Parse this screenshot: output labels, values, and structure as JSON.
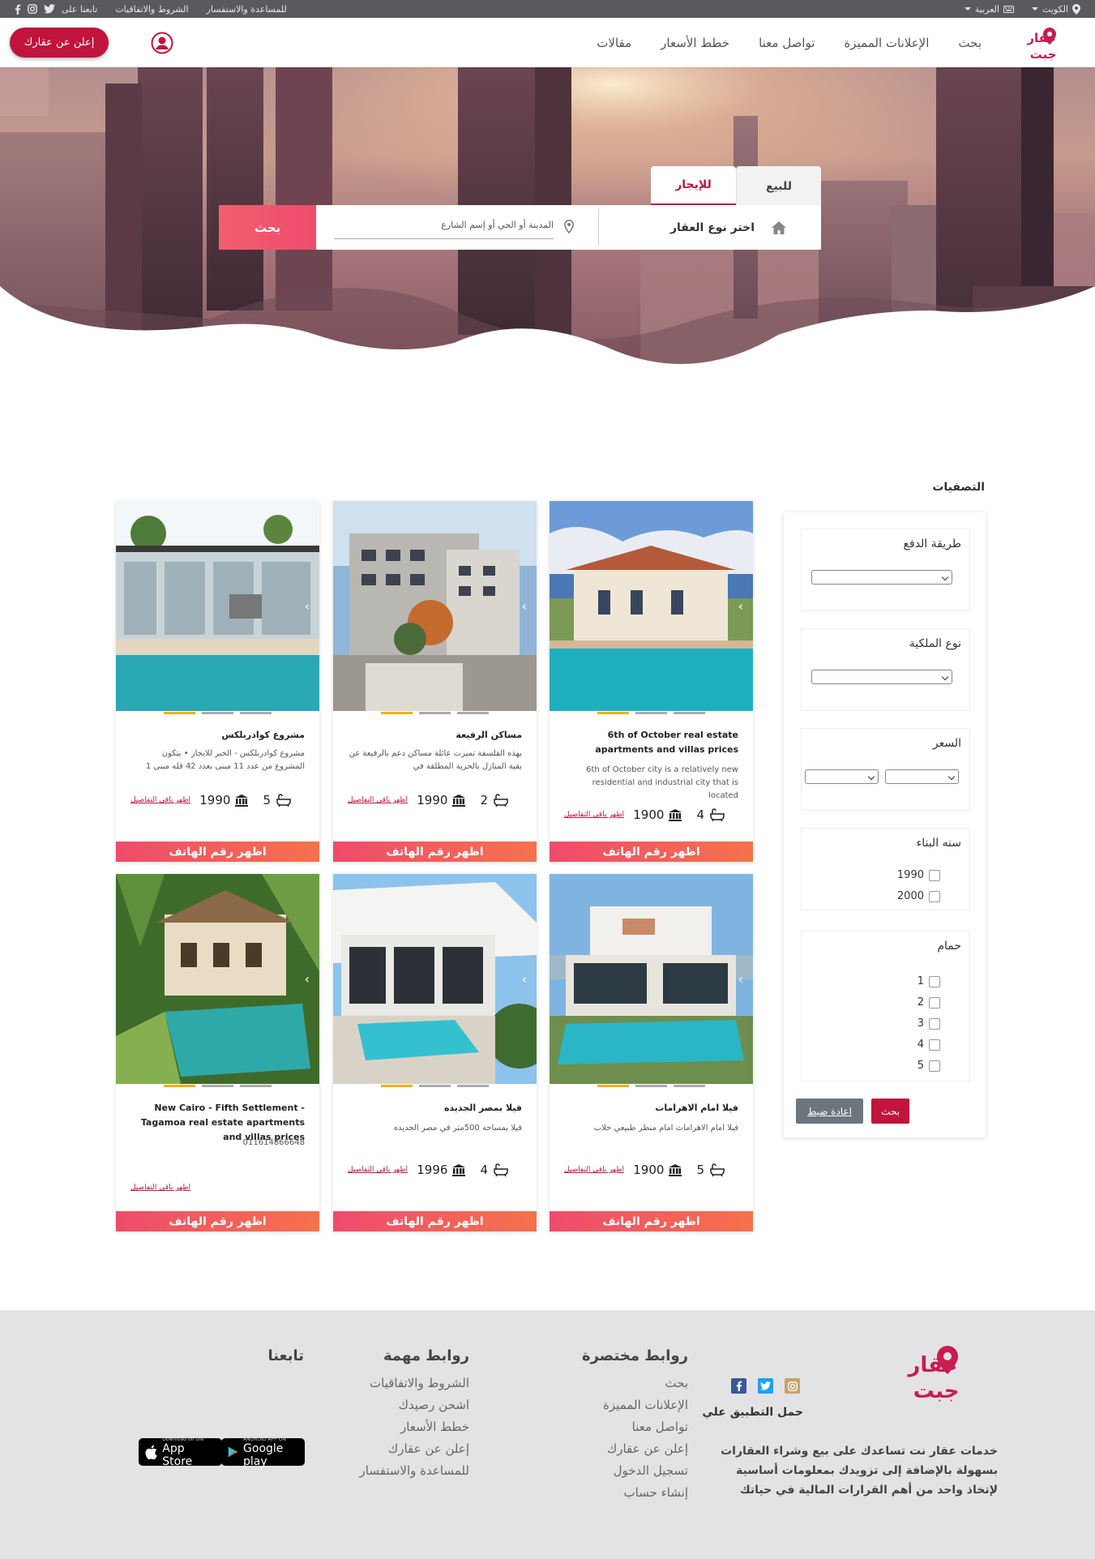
{
  "topbar": {
    "country": "الكويت",
    "language": "العربية",
    "help_link": "للمساعدة والاستفسار",
    "terms_link": "الشروط والاتفاقيات",
    "follow_label": "تابعنا على"
  },
  "header": {
    "logo_line1": "عقار",
    "logo_line2": "جبت",
    "nav": [
      "بحث",
      "الإعلانات المميزة",
      "تواصل معنا",
      "خطط الأسعار",
      "مقالات"
    ],
    "cta": "إعلن عن عقارك"
  },
  "hero": {
    "tab_sale": "للبيع",
    "tab_rent": "للإيجار",
    "property_type_placeholder": "اختر نوع العقار",
    "location_placeholder": "المدينة أو الحي أو إسم الشارع",
    "search_button": "بحث"
  },
  "filters": {
    "heading": "التصفيات",
    "payment_method": "طريقة الدفع",
    "ownership_type": "نوع الملكية",
    "price": "السعر",
    "build_year": "سنه البناء",
    "build_year_options": [
      "1990",
      "2000"
    ],
    "bathrooms": "حمام",
    "bathroom_options": [
      "1",
      "2",
      "3",
      "4",
      "5"
    ],
    "search_button": "بحث",
    "reset_button": "اعادة ضبط"
  },
  "listings": [
    {
      "title": "6th of October real estate apartments and villas prices",
      "description": "6th of October city is a relatively new residential and industrial city that is located",
      "bathrooms": "4",
      "year": "1900",
      "more_label": "اظهر باقي التفاصيل",
      "phone_label": "اظهر رقم الهاتف"
    },
    {
      "title": "مساكن الرفيعة",
      "description": "بهذه الفلسفة تميزت عائلة مساكن دعم بالرفيعة عن بقية المنازل بالحرية المطلقة في",
      "bathrooms": "2",
      "year": "1990",
      "more_label": "اظهر باقي التفاصيل",
      "phone_label": "اظهر رقم الهاتف"
    },
    {
      "title": "مشروع كوادربلكس",
      "description": "مشروع كوادربلكس - الخبر للايجار • يتكون المشروع من عدد 11 مبنى بعدد 42 فله مبنى 1",
      "bathrooms": "5",
      "year": "1990",
      "more_label": "اظهر باقي التفاصيل",
      "phone_label": "اظهر رقم الهاتف"
    },
    {
      "title": "فيلا امام الاهرامات",
      "description": "فيلا امام الاهرامات امام منظر طبيعي خلاب",
      "bathrooms": "5",
      "year": "1900",
      "more_label": "اظهر باقي التفاصيل",
      "phone_label": "اظهر رقم الهاتف"
    },
    {
      "title": "فيلا بمصر الجديده",
      "description": "فيلا بمساحه 500متر في مصر الجديده",
      "bathrooms": "4",
      "year": "1996",
      "more_label": "اظهر باقي التفاصيل",
      "phone_label": "اظهر رقم الهاتف"
    },
    {
      "title": "New Cairo - Fifth Settlement - Tagamoa real estate apartments and villas prices",
      "description": "011614866648",
      "bathrooms": "",
      "year": "",
      "more_label": "اظهر باقي التفاصيل",
      "phone_label": "اظهر رقم الهاتف"
    }
  ],
  "footer": {
    "logo_line1": "عقار",
    "logo_line2": "جبت",
    "description": "خدمات عقار نت تساعدك على بيع وشراء العقارات بسهولة بالإضافة إلى تزويدك بمعلومات أساسية لإتخاذ واحد من أهم القرارات المالية في حياتك",
    "quick_links_title": "روابط مختصرة",
    "quick_links": [
      "بحث",
      "الإعلانات المميزة",
      "تواصل معنا",
      "إعلن عن عقارك",
      "تسجيل الدخول",
      "إنشاء حساب"
    ],
    "important_links_title": "روابط مهمة",
    "important_links": [
      "الشروط والاتفاقيات",
      "اشحن رصيدك",
      "خطط الأسعار",
      "إعلن عن عقارك",
      "للمساعدة والاستفسار"
    ],
    "follow_title": "تابعنا",
    "app_title": "حمل التطبيق علي",
    "app_store_small": "Download on the",
    "app_store": "App Store",
    "google_play_small": "ANDROID APP ON",
    "google_play": "Google play"
  },
  "colors": {
    "brand": "#c0143c",
    "phone_gradient_start": "#ef4b6c",
    "phone_gradient_end": "#f5724c",
    "footer_bg": "#e3e3e6",
    "topbar_bg": "#5a5a5e"
  },
  "icons": [
    "location-pin-icon",
    "keyboard-icon",
    "instagram-icon",
    "twitter-icon",
    "facebook-icon",
    "user-icon",
    "home-icon",
    "bathtub-icon",
    "building-icon",
    "chevron-right-icon"
  ]
}
